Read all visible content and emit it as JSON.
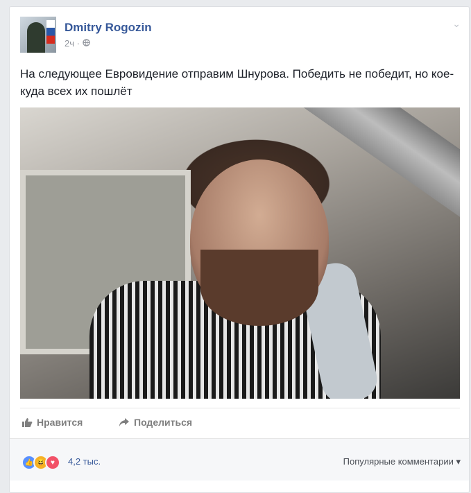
{
  "author": {
    "name": "Dmitry Rogozin",
    "time": "2ч"
  },
  "post": {
    "text": "На следующее Евровидение отправим Шнурова. Победить не победит, но кое-куда всех их пошлёт"
  },
  "actions": {
    "like": "Нравится",
    "share": "Поделиться"
  },
  "reactions": {
    "count": "4,2 тыс.",
    "sort": "Популярные комментарии"
  },
  "icons": {
    "privacy": "globe-icon",
    "menu": "chevron-down-icon",
    "like": "thumbs-up-icon",
    "share": "share-arrow-icon"
  },
  "colors": {
    "link": "#365899",
    "reaction_like": "#5890ff",
    "reaction_haha": "#f7b125",
    "reaction_love": "#f25268"
  }
}
